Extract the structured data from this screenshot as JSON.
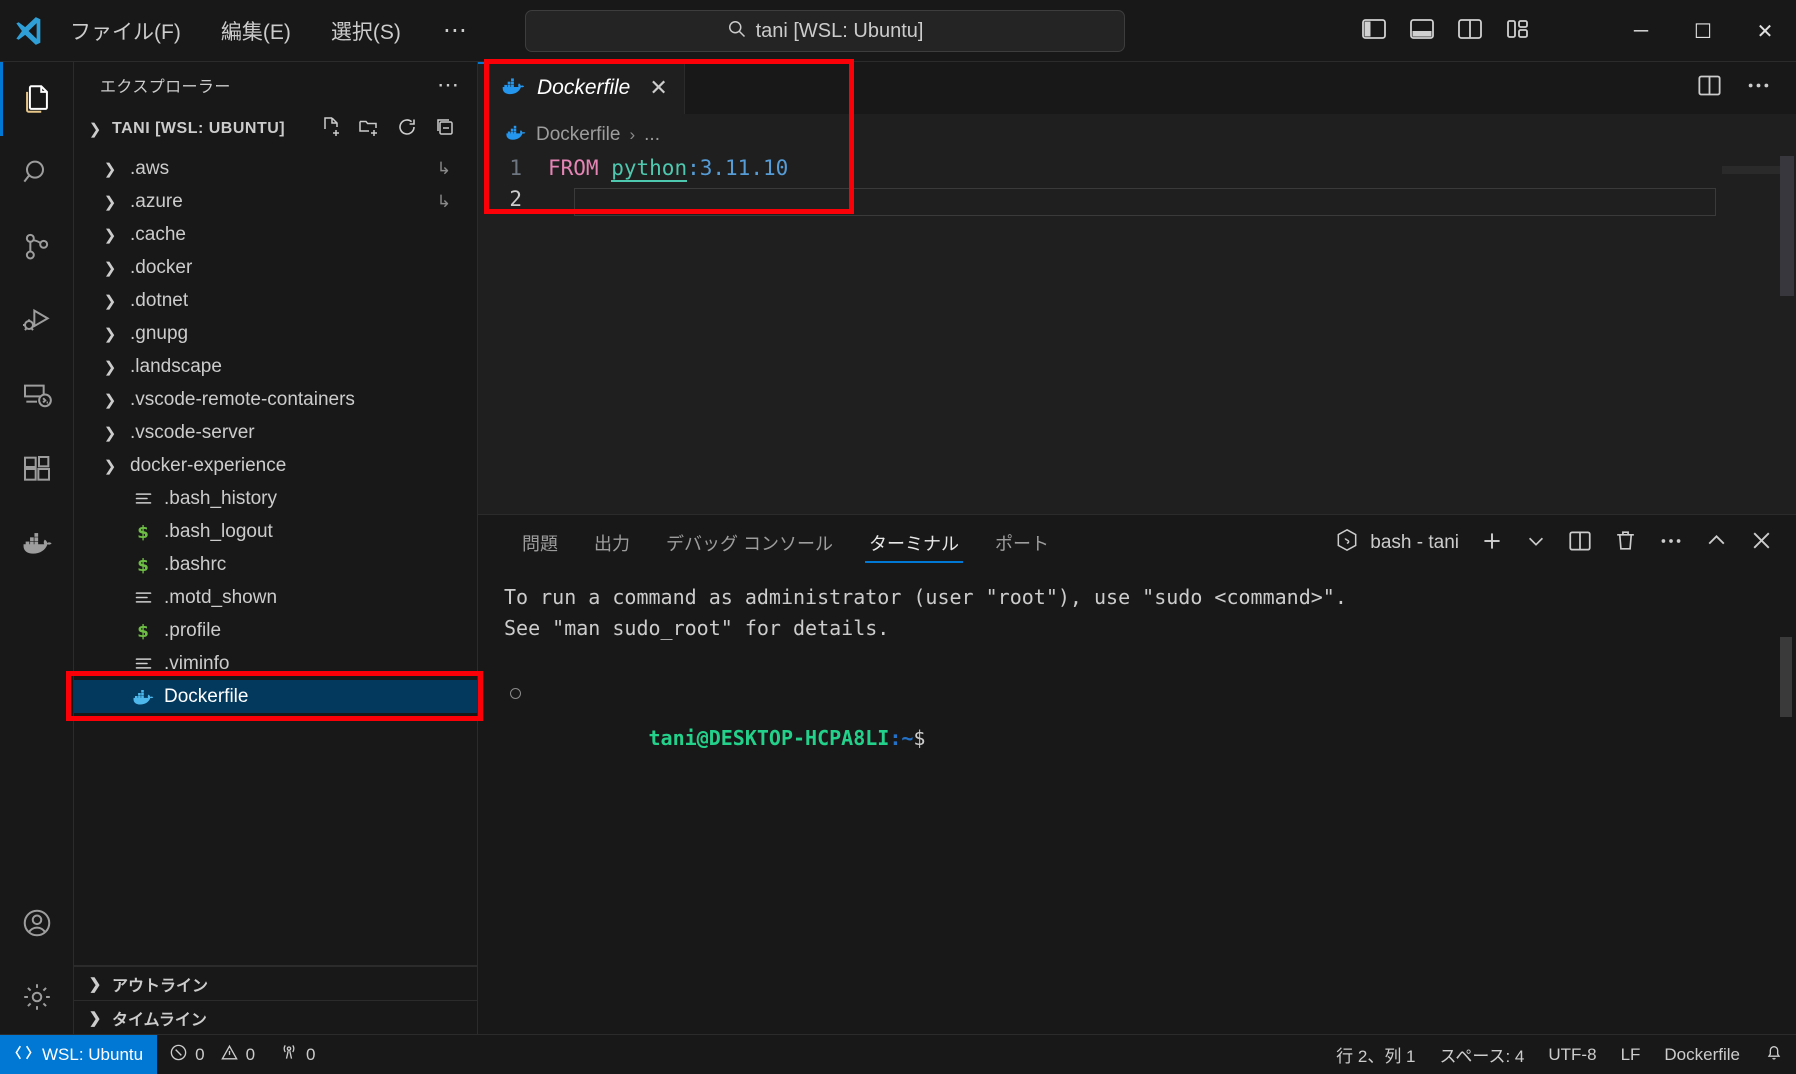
{
  "titlebar": {
    "menu": [
      {
        "label": "ファイル(F)"
      },
      {
        "label": "編集(E)"
      },
      {
        "label": "選択(S)"
      },
      {
        "label": "⋯"
      }
    ],
    "nav_back": "←",
    "nav_forward": "→",
    "search": {
      "value": "tani [WSL: Ubuntu]",
      "icon": "search-icon"
    },
    "layout_icons": [
      "toggle-primary-sidebar-icon",
      "toggle-panel-icon",
      "toggle-secondary-sidebar-icon",
      "customize-layout-icon"
    ],
    "window_controls": {
      "minimize": "─",
      "maximize": "☐",
      "close": "✕"
    }
  },
  "activitybar": {
    "items": [
      {
        "name": "explorer",
        "active": true
      },
      {
        "name": "search",
        "active": false
      },
      {
        "name": "source-control",
        "active": false
      },
      {
        "name": "run-and-debug",
        "active": false
      },
      {
        "name": "remote-explorer",
        "active": false
      },
      {
        "name": "extensions",
        "active": false
      },
      {
        "name": "docker",
        "active": false
      }
    ],
    "bottom": [
      {
        "name": "accounts"
      },
      {
        "name": "settings"
      }
    ]
  },
  "sidebar": {
    "title": "エクスプローラー",
    "more_actions": "⋯",
    "root": {
      "label": "TANI [WSL: UBUNTU]",
      "expanded": true,
      "actions": [
        "new-file-icon",
        "new-folder-icon",
        "refresh-icon",
        "collapse-all-icon"
      ]
    },
    "tree": [
      {
        "label": ".aws",
        "type": "folder",
        "link": true
      },
      {
        "label": ".azure",
        "type": "folder",
        "link": true
      },
      {
        "label": ".cache",
        "type": "folder",
        "link": false
      },
      {
        "label": ".docker",
        "type": "folder",
        "link": false
      },
      {
        "label": ".dotnet",
        "type": "folder",
        "link": false
      },
      {
        "label": ".gnupg",
        "type": "folder",
        "link": false
      },
      {
        "label": ".landscape",
        "type": "folder",
        "link": false
      },
      {
        "label": ".vscode-remote-containers",
        "type": "folder",
        "link": false
      },
      {
        "label": ".vscode-server",
        "type": "folder",
        "link": false
      },
      {
        "label": "docker-experience",
        "type": "folder",
        "link": false
      },
      {
        "label": ".bash_history",
        "type": "file-text",
        "link": false
      },
      {
        "label": ".bash_logout",
        "type": "file-shell",
        "link": false
      },
      {
        "label": ".bashrc",
        "type": "file-shell",
        "link": false
      },
      {
        "label": ".motd_shown",
        "type": "file-text",
        "link": false
      },
      {
        "label": ".profile",
        "type": "file-shell",
        "link": false
      },
      {
        "label": ".viminfo",
        "type": "file-text",
        "link": false
      },
      {
        "label": "Dockerfile",
        "type": "file-docker",
        "link": false,
        "selected": true
      }
    ],
    "sections": [
      {
        "label": "アウトライン"
      },
      {
        "label": "タイムライン"
      }
    ]
  },
  "editor": {
    "tabs": [
      {
        "label": "Dockerfile",
        "icon": "docker-icon",
        "close": "✕",
        "active": true,
        "preview": true
      }
    ],
    "tab_actions": [
      "split-editor-icon",
      "more-actions-icon"
    ],
    "breadcrumb": {
      "icon": "docker-icon",
      "file": "Dockerfile",
      "separator": "›",
      "tail": "..."
    },
    "code": {
      "lines": [
        {
          "number": "1",
          "tokens": [
            {
              "text": "FROM",
              "kind": "keyword"
            },
            {
              "text": " ",
              "kind": "plain"
            },
            {
              "text": "python",
              "kind": "image"
            },
            {
              "text": ":",
              "kind": "colon"
            },
            {
              "text": "3.11.10",
              "kind": "tag"
            }
          ]
        },
        {
          "number": "2",
          "tokens": []
        }
      ]
    }
  },
  "panel": {
    "tabs": [
      {
        "label": "問題",
        "active": false
      },
      {
        "label": "出力",
        "active": false
      },
      {
        "label": "デバッグ コンソール",
        "active": false
      },
      {
        "label": "ターミナル",
        "active": true
      },
      {
        "label": "ポート",
        "active": false
      }
    ],
    "terminal_name": "bash - tani",
    "actions": [
      "new-terminal-icon",
      "terminal-dropdown-icon",
      "split-terminal-icon",
      "kill-terminal-icon",
      "panel-more-icon",
      "maximize-panel-icon",
      "close-panel-icon"
    ],
    "terminal_lines": [
      {
        "text": "To run a command as administrator (user \"root\"), use \"sudo <command>\".",
        "kind": "plain"
      },
      {
        "text": "See \"man sudo_root\" for details.",
        "kind": "plain"
      },
      {
        "text": "",
        "kind": "plain"
      }
    ],
    "prompt": {
      "user": "tani@DESKTOP-HCPA8LI",
      "path": ":~",
      "symbol": "$"
    }
  },
  "statusbar": {
    "remote": {
      "label": "WSL: Ubuntu",
      "icon": "remote-icon",
      "color": "#0078d4"
    },
    "problems": {
      "errors": "0",
      "warnings": "0"
    },
    "radio_tower": "0",
    "right": [
      {
        "label": "行 2、列 1",
        "name": "cursor-position"
      },
      {
        "label": "スペース: 4",
        "name": "indentation"
      },
      {
        "label": "UTF-8",
        "name": "encoding"
      },
      {
        "label": "LF",
        "name": "eol"
      },
      {
        "label": "Dockerfile",
        "name": "language-mode"
      }
    ],
    "bell": "bell-icon"
  },
  "annotations": [
    {
      "name": "editor-highlight",
      "color": "#fb0007"
    },
    {
      "name": "file-highlight",
      "color": "#fb0007"
    }
  ]
}
